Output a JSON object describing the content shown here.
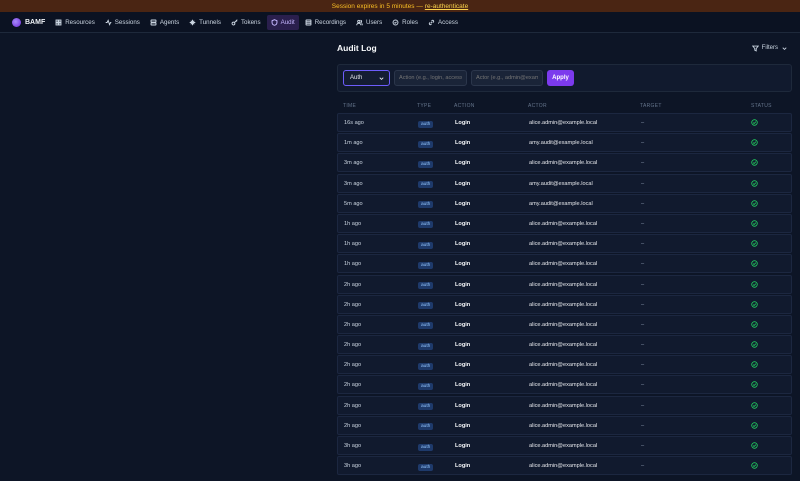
{
  "banner": {
    "message": "Session expires in 5 minutes —",
    "link": "re-authenticate"
  },
  "brand": {
    "name": "BAMF"
  },
  "nav": [
    {
      "key": "resources",
      "label": "Resources",
      "icon": "grid-icon"
    },
    {
      "key": "sessions",
      "label": "Sessions",
      "icon": "activity-icon"
    },
    {
      "key": "agents",
      "label": "Agents",
      "icon": "server-icon"
    },
    {
      "key": "tunnels",
      "label": "Tunnels",
      "icon": "tunnel-icon"
    },
    {
      "key": "tokens",
      "label": "Tokens",
      "icon": "key-icon"
    },
    {
      "key": "audit",
      "label": "Audit",
      "icon": "shield-icon",
      "active": true
    },
    {
      "key": "recordings",
      "label": "Recordings",
      "icon": "film-icon"
    },
    {
      "key": "users",
      "label": "Users",
      "icon": "users-icon"
    },
    {
      "key": "roles",
      "label": "Roles",
      "icon": "roles-icon"
    },
    {
      "key": "access",
      "label": "Access",
      "icon": "link-icon"
    }
  ],
  "page": {
    "title": "Audit Log",
    "filters_label": "Filters"
  },
  "filter_bar": {
    "type_select": "Auth",
    "action_placeholder": "Action (e.g., login, access)",
    "actor_placeholder": "Actor (e.g., admin@example)",
    "apply_label": "Apply"
  },
  "table": {
    "columns": {
      "time": "TIME",
      "type": "TYPE",
      "action": "ACTION",
      "actor": "ACTOR",
      "target": "TARGET",
      "status": "STATUS"
    },
    "rows": [
      {
        "time": "16s ago",
        "type": "auth",
        "action": "Login",
        "actor": "alice.admin@example.local",
        "target": "–",
        "status": "success"
      },
      {
        "time": "1m ago",
        "type": "auth",
        "action": "Login",
        "actor": "amy.audit@example.local",
        "target": "–",
        "status": "success"
      },
      {
        "time": "3m ago",
        "type": "auth",
        "action": "Login",
        "actor": "alice.admin@example.local",
        "target": "–",
        "status": "success"
      },
      {
        "time": "3m ago",
        "type": "auth",
        "action": "Login",
        "actor": "amy.audit@example.local",
        "target": "–",
        "status": "success"
      },
      {
        "time": "5m ago",
        "type": "auth",
        "action": "Login",
        "actor": "amy.audit@example.local",
        "target": "–",
        "status": "success"
      },
      {
        "time": "1h ago",
        "type": "auth",
        "action": "Login",
        "actor": "alice.admin@example.local",
        "target": "–",
        "status": "success"
      },
      {
        "time": "1h ago",
        "type": "auth",
        "action": "Login",
        "actor": "alice.admin@example.local",
        "target": "–",
        "status": "success"
      },
      {
        "time": "1h ago",
        "type": "auth",
        "action": "Login",
        "actor": "alice.admin@example.local",
        "target": "–",
        "status": "success"
      },
      {
        "time": "2h ago",
        "type": "auth",
        "action": "Login",
        "actor": "alice.admin@example.local",
        "target": "–",
        "status": "success"
      },
      {
        "time": "2h ago",
        "type": "auth",
        "action": "Login",
        "actor": "alice.admin@example.local",
        "target": "–",
        "status": "success"
      },
      {
        "time": "2h ago",
        "type": "auth",
        "action": "Login",
        "actor": "alice.admin@example.local",
        "target": "–",
        "status": "success"
      },
      {
        "time": "2h ago",
        "type": "auth",
        "action": "Login",
        "actor": "alice.admin@example.local",
        "target": "–",
        "status": "success"
      },
      {
        "time": "2h ago",
        "type": "auth",
        "action": "Login",
        "actor": "alice.admin@example.local",
        "target": "–",
        "status": "success"
      },
      {
        "time": "2h ago",
        "type": "auth",
        "action": "Login",
        "actor": "alice.admin@example.local",
        "target": "–",
        "status": "success"
      },
      {
        "time": "2h ago",
        "type": "auth",
        "action": "Login",
        "actor": "alice.admin@example.local",
        "target": "–",
        "status": "success"
      },
      {
        "time": "2h ago",
        "type": "auth",
        "action": "Login",
        "actor": "alice.admin@example.local",
        "target": "–",
        "status": "success"
      },
      {
        "time": "3h ago",
        "type": "auth",
        "action": "Login",
        "actor": "alice.admin@example.local",
        "target": "–",
        "status": "success"
      },
      {
        "time": "3h ago",
        "type": "auth",
        "action": "Login",
        "actor": "alice.admin@example.local",
        "target": "–",
        "status": "success"
      }
    ]
  },
  "colors": {
    "banner_bg": "#4a2513",
    "accent": "#7c3aed",
    "success": "#22c55e",
    "bg": "#0d1526"
  }
}
